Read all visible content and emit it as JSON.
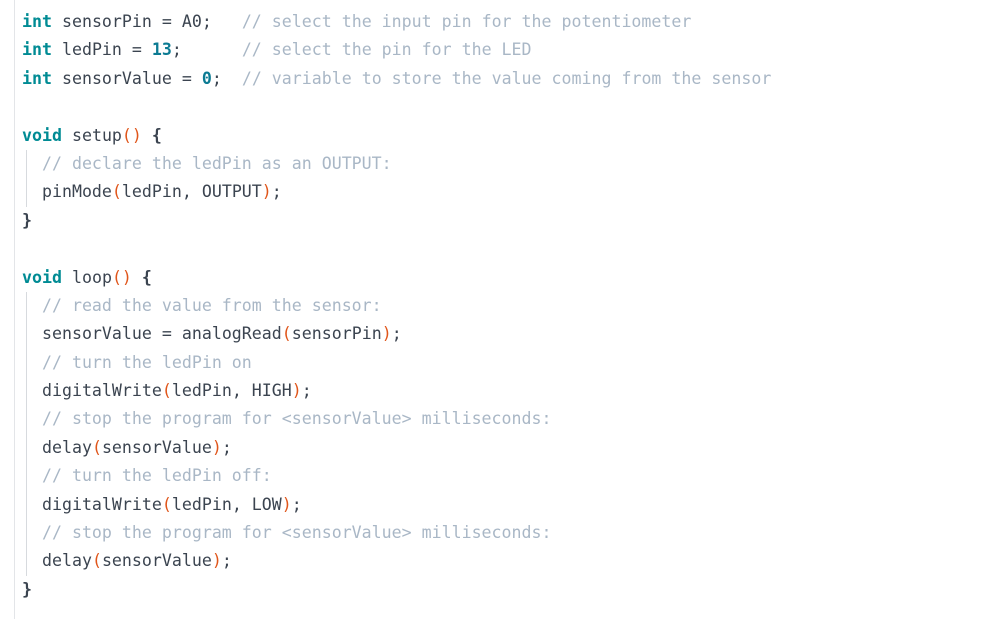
{
  "document": {
    "kind": "source-code-listing",
    "language": "Arduino C++",
    "background_color": "#ffffff",
    "colors": {
      "keyword": "#008b94",
      "function": "#e0561b",
      "number": "#0c7b93",
      "comment": "#a9b7c6",
      "plain": "#3b4450",
      "gutter_rule": "#e3e5e8",
      "indent_guide": "#d7dade"
    }
  },
  "code": {
    "lines": [
      {
        "n": 1,
        "indent": false,
        "text": "int sensorPin = A0;   // select the input pin for the potentiometer",
        "tokens": [
          {
            "t": "int",
            "c": "keyword"
          },
          {
            "t": " sensorPin = A0;   ",
            "c": "plain"
          },
          {
            "t": "// select the input pin for the potentiometer",
            "c": "comment"
          }
        ]
      },
      {
        "n": 2,
        "indent": false,
        "text": "int ledPin = 13;      // select the pin for the LED",
        "tokens": [
          {
            "t": "int",
            "c": "keyword"
          },
          {
            "t": " ledPin = ",
            "c": "plain"
          },
          {
            "t": "13",
            "c": "number"
          },
          {
            "t": ";      ",
            "c": "plain"
          },
          {
            "t": "// select the pin for the LED",
            "c": "comment"
          }
        ]
      },
      {
        "n": 3,
        "indent": false,
        "text": "int sensorValue = 0;  // variable to store the value coming from the sensor",
        "tokens": [
          {
            "t": "int",
            "c": "keyword"
          },
          {
            "t": " sensorValue = ",
            "c": "plain"
          },
          {
            "t": "0",
            "c": "number"
          },
          {
            "t": ";  ",
            "c": "plain"
          },
          {
            "t": "// variable to store the value coming from the sensor",
            "c": "comment"
          }
        ]
      },
      {
        "n": 4,
        "indent": false,
        "text": "",
        "tokens": []
      },
      {
        "n": 5,
        "indent": false,
        "text": "void setup() {",
        "tokens": [
          {
            "t": "void",
            "c": "keyword"
          },
          {
            "t": " ",
            "c": "plain"
          },
          {
            "t": "setup",
            "c": "function"
          },
          {
            "t": "()",
            "c": "paren"
          },
          {
            "t": " ",
            "c": "plain"
          },
          {
            "t": "{",
            "c": "brace"
          }
        ]
      },
      {
        "n": 6,
        "indent": true,
        "text": "  // declare the ledPin as an OUTPUT:",
        "tokens": [
          {
            "t": "  ",
            "c": "plain"
          },
          {
            "t": "// declare the ledPin as an OUTPUT:",
            "c": "comment"
          }
        ]
      },
      {
        "n": 7,
        "indent": true,
        "text": "  pinMode(ledPin, OUTPUT);",
        "tokens": [
          {
            "t": "  ",
            "c": "plain"
          },
          {
            "t": "pinMode",
            "c": "function"
          },
          {
            "t": "(",
            "c": "paren"
          },
          {
            "t": "ledPin, OUTPUT",
            "c": "plain"
          },
          {
            "t": ")",
            "c": "paren"
          },
          {
            "t": ";",
            "c": "plain"
          }
        ]
      },
      {
        "n": 8,
        "indent": false,
        "text": "}",
        "tokens": [
          {
            "t": "}",
            "c": "brace"
          }
        ]
      },
      {
        "n": 9,
        "indent": false,
        "text": "",
        "tokens": []
      },
      {
        "n": 10,
        "indent": false,
        "text": "void loop() {",
        "tokens": [
          {
            "t": "void",
            "c": "keyword"
          },
          {
            "t": " ",
            "c": "plain"
          },
          {
            "t": "loop",
            "c": "function"
          },
          {
            "t": "()",
            "c": "paren"
          },
          {
            "t": " ",
            "c": "plain"
          },
          {
            "t": "{",
            "c": "brace"
          }
        ]
      },
      {
        "n": 11,
        "indent": true,
        "text": "  // read the value from the sensor:",
        "tokens": [
          {
            "t": "  ",
            "c": "plain"
          },
          {
            "t": "// read the value from the sensor:",
            "c": "comment"
          }
        ]
      },
      {
        "n": 12,
        "indent": true,
        "text": "  sensorValue = analogRead(sensorPin);",
        "tokens": [
          {
            "t": "  sensorValue = ",
            "c": "plain"
          },
          {
            "t": "analogRead",
            "c": "function"
          },
          {
            "t": "(",
            "c": "paren"
          },
          {
            "t": "sensorPin",
            "c": "plain"
          },
          {
            "t": ")",
            "c": "paren"
          },
          {
            "t": ";",
            "c": "plain"
          }
        ]
      },
      {
        "n": 13,
        "indent": true,
        "text": "  // turn the ledPin on",
        "tokens": [
          {
            "t": "  ",
            "c": "plain"
          },
          {
            "t": "// turn the ledPin on",
            "c": "comment"
          }
        ]
      },
      {
        "n": 14,
        "indent": true,
        "text": "  digitalWrite(ledPin, HIGH);",
        "tokens": [
          {
            "t": "  ",
            "c": "plain"
          },
          {
            "t": "digitalWrite",
            "c": "function"
          },
          {
            "t": "(",
            "c": "paren"
          },
          {
            "t": "ledPin, HIGH",
            "c": "plain"
          },
          {
            "t": ")",
            "c": "paren"
          },
          {
            "t": ";",
            "c": "plain"
          }
        ]
      },
      {
        "n": 15,
        "indent": true,
        "text": "  // stop the program for <sensorValue> milliseconds:",
        "tokens": [
          {
            "t": "  ",
            "c": "plain"
          },
          {
            "t": "// stop the program for <sensorValue> milliseconds:",
            "c": "comment"
          }
        ]
      },
      {
        "n": 16,
        "indent": true,
        "text": "  delay(sensorValue);",
        "tokens": [
          {
            "t": "  ",
            "c": "plain"
          },
          {
            "t": "delay",
            "c": "function"
          },
          {
            "t": "(",
            "c": "paren"
          },
          {
            "t": "sensorValue",
            "c": "plain"
          },
          {
            "t": ")",
            "c": "paren"
          },
          {
            "t": ";",
            "c": "plain"
          }
        ]
      },
      {
        "n": 17,
        "indent": true,
        "text": "  // turn the ledPin off:",
        "tokens": [
          {
            "t": "  ",
            "c": "plain"
          },
          {
            "t": "// turn the ledPin off:",
            "c": "comment"
          }
        ]
      },
      {
        "n": 18,
        "indent": true,
        "text": "  digitalWrite(ledPin, LOW);",
        "tokens": [
          {
            "t": "  ",
            "c": "plain"
          },
          {
            "t": "digitalWrite",
            "c": "function"
          },
          {
            "t": "(",
            "c": "paren"
          },
          {
            "t": "ledPin, LOW",
            "c": "plain"
          },
          {
            "t": ")",
            "c": "paren"
          },
          {
            "t": ";",
            "c": "plain"
          }
        ]
      },
      {
        "n": 19,
        "indent": true,
        "text": "  // stop the program for <sensorValue> milliseconds:",
        "tokens": [
          {
            "t": "  ",
            "c": "plain"
          },
          {
            "t": "// stop the program for <sensorValue> milliseconds:",
            "c": "comment"
          }
        ]
      },
      {
        "n": 20,
        "indent": true,
        "text": "  delay(sensorValue);",
        "tokens": [
          {
            "t": "  ",
            "c": "plain"
          },
          {
            "t": "delay",
            "c": "function"
          },
          {
            "t": "(",
            "c": "paren"
          },
          {
            "t": "sensorValue",
            "c": "plain"
          },
          {
            "t": ")",
            "c": "paren"
          },
          {
            "t": ";",
            "c": "plain"
          }
        ]
      },
      {
        "n": 21,
        "indent": false,
        "text": "}",
        "tokens": [
          {
            "t": "}",
            "c": "brace"
          }
        ]
      }
    ]
  }
}
